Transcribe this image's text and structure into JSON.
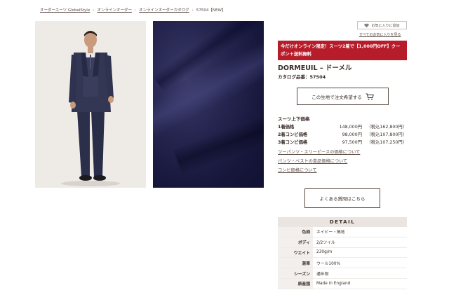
{
  "breadcrumb": {
    "items": [
      "オーダースーツ GlobalStyle",
      "オンラインオーダー",
      "オンラインオーダーカタログ",
      "57504【NEW】"
    ],
    "separator": "›"
  },
  "favorites": {
    "add_label": "お気に入りに追加",
    "view_all": "すべてのお気に入りを見る"
  },
  "promo": {
    "text": "今だけオンライン限定！スーツ2着で【1,000円OFF】クーポン＋送料無料",
    "color": "#b71c2a"
  },
  "product": {
    "title": "DORMEUIL – ドーメル",
    "catalog_no": "カタログ品番：57504",
    "order_button": "この生地で注文希望する"
  },
  "pricing": {
    "heading": "スーツ上下価格",
    "rows": [
      {
        "label": "1着価格",
        "price": "148,000円",
        "tax": "（税込162,800円）"
      },
      {
        "label": "2着コンビ価格",
        "price": "98,000円",
        "tax": "（税込107,800円）"
      },
      {
        "label": "3着コンビ価格",
        "price": "97,500円",
        "tax": "（税込107,250円）"
      }
    ],
    "links": [
      "ツーパンツ・スリーピースの価格について",
      "パンツ・ベストの単品価格について",
      "コンビ価格について"
    ]
  },
  "faq_button": "よくある質問はこちら",
  "detail": {
    "heading": "DETAIL",
    "rows": [
      {
        "key": "色柄",
        "value": "ネイビー・無地"
      },
      {
        "key": "ボディ",
        "value": "2/2ツイル"
      },
      {
        "key": "ウエイト",
        "value": "230g/m"
      },
      {
        "key": "混率",
        "value": "ウール100%"
      },
      {
        "key": "シーズン",
        "value": "通年物"
      },
      {
        "key": "原産国",
        "value": "Made in England"
      }
    ]
  },
  "icons": {
    "heart": "heart-icon",
    "cart": "cart-icon"
  }
}
